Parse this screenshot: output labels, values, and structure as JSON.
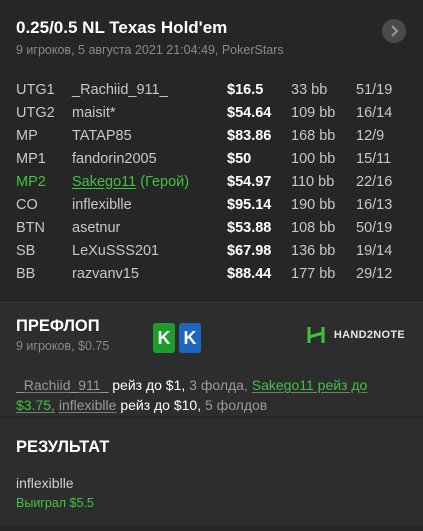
{
  "header": {
    "title": "0.25/0.5 NL Texas Hold'em",
    "subtitle": "9 игроков, 5 августа 2021 21:04:49, PokerStars",
    "next_icon": "chevron-right-icon"
  },
  "players": [
    {
      "pos": "UTG1",
      "name": "_Rachiid_911_",
      "stack": "$16.5",
      "bb": "33 bb",
      "hands": "51/19"
    },
    {
      "pos": "UTG2",
      "name": "maisit*",
      "stack": "$54.64",
      "bb": "109 bb",
      "hands": "16/14"
    },
    {
      "pos": "MP",
      "name": "TATAP85",
      "stack": "$83.86",
      "bb": "168 bb",
      "hands": "12/9"
    },
    {
      "pos": "MP1",
      "name": "fandorin2005",
      "stack": "$50",
      "bb": "100 bb",
      "hands": "15/11"
    },
    {
      "pos": "MP2",
      "name": "Sakego11",
      "hero_label": "(Герой)",
      "stack": "$54.97",
      "bb": "110 bb",
      "hands": "22/16"
    },
    {
      "pos": "CO",
      "name": "inflexiblle",
      "stack": "$95.14",
      "bb": "190 bb",
      "hands": "16/13"
    },
    {
      "pos": "BTN",
      "name": "asetnur",
      "stack": "$53.88",
      "bb": "108 bb",
      "hands": "50/19"
    },
    {
      "pos": "SB",
      "name": "LeXuSSS201",
      "stack": "$67.98",
      "bb": "136 bb",
      "hands": "19/14"
    },
    {
      "pos": "BB",
      "name": "razvanv15",
      "stack": "$88.44",
      "bb": "177 bb",
      "hands": "29/12"
    }
  ],
  "preflop": {
    "title": "ПРЕФЛОП",
    "subtitle": "9 игроков, $0.75",
    "cards": [
      "K",
      "K"
    ],
    "card_colors": [
      "#1f9b2c",
      "#1f66c0"
    ],
    "brand": "HAND2NOTE",
    "actions": {
      "p1": "_Rachiid_911_",
      "a1": "рейз до $1,",
      "f1": "3 фолда,",
      "hero": "Sakego11 рейз до $3.75,",
      "p2": "inflexiblle",
      "a2": "рейз до $10,",
      "f2": "5 фолдов"
    }
  },
  "result": {
    "title": "РЕЗУЛЬТАТ",
    "winner": "inflexiblle",
    "won": "Выиграл $5.5"
  },
  "colors": {
    "background": "#262626",
    "panel": "#2d2d2d",
    "hero": "#42c242"
  }
}
